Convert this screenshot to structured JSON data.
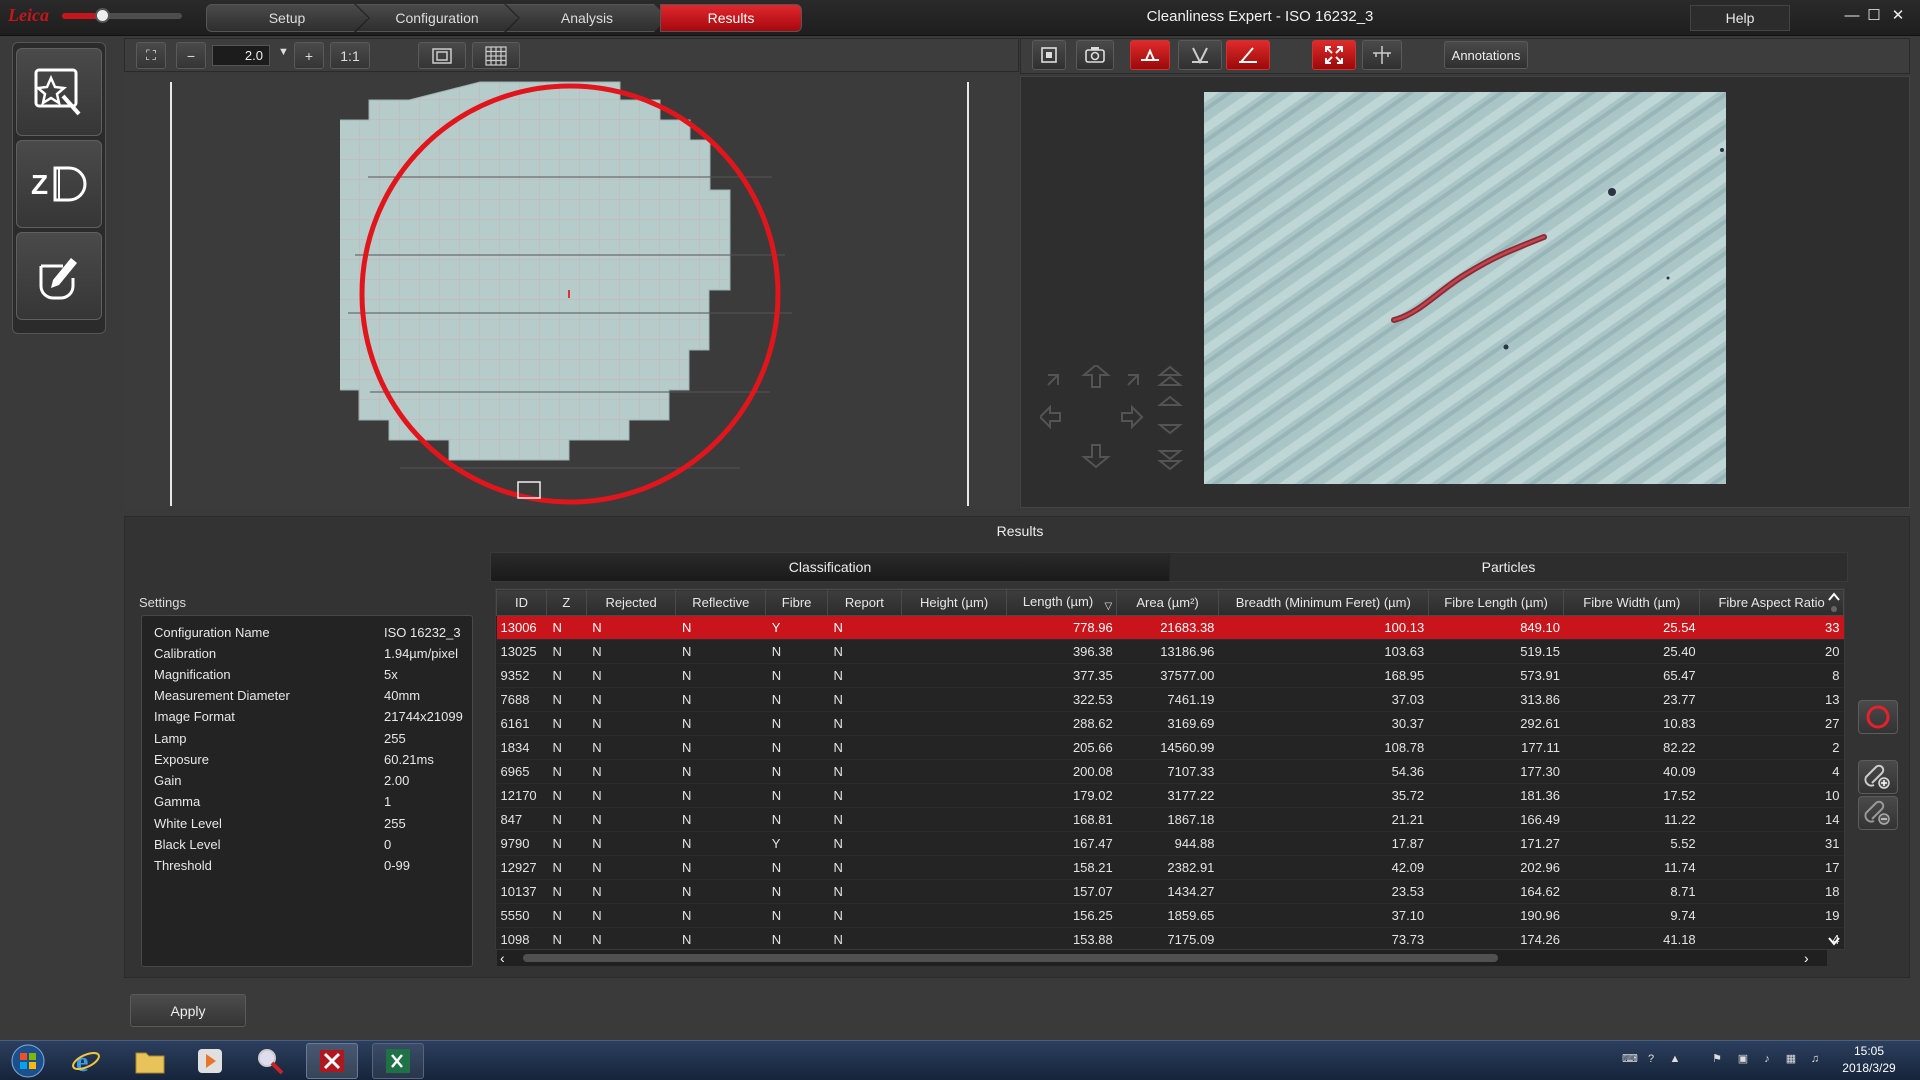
{
  "titlebar": {
    "logo_text": "Leica",
    "workflow_tabs": [
      {
        "label": "Setup"
      },
      {
        "label": "Configuration"
      },
      {
        "label": "Analysis"
      },
      {
        "label": "Results",
        "active": true
      }
    ],
    "app_title": "Cleanliness Expert - ISO 16232_3",
    "help_label": "Help",
    "accent_color": "#c4161c"
  },
  "left_toolbar": {
    "zoom_value": "2.0",
    "zoom_minus": "−",
    "zoom_plus": "+",
    "one_to_one": "1:1"
  },
  "right_toolbar": {
    "annotations_label": "Annotations"
  },
  "results": {
    "title": "Results",
    "tabs": [
      "Classification",
      "Particles"
    ],
    "active_tab": "Classification"
  },
  "settings": {
    "title": "Settings",
    "rows": [
      {
        "key": "Configuration Name",
        "value": "ISO 16232_3"
      },
      {
        "key": "Calibration",
        "value": "1.94µm/pixel"
      },
      {
        "key": "Magnification",
        "value": "5x"
      },
      {
        "key": "Measurement Diameter",
        "value": "40mm"
      },
      {
        "key": "Image Format",
        "value": "21744x21099"
      },
      {
        "key": "Lamp",
        "value": "255"
      },
      {
        "key": "Exposure",
        "value": "60.21ms"
      },
      {
        "key": "Gain",
        "value": "2.00"
      },
      {
        "key": "Gamma",
        "value": "1"
      },
      {
        "key": "White Level",
        "value": "255"
      },
      {
        "key": "Black Level",
        "value": "0"
      },
      {
        "key": "Threshold",
        "value": "0-99"
      }
    ]
  },
  "table": {
    "columns": [
      "ID",
      "Z",
      "Rejected",
      "Reflective",
      "Fibre",
      "Report",
      "Height (µm)",
      "Length (µm)",
      "Area (µm²)",
      "Breadth (Minimum Feret) (µm)",
      "Fibre Length (µm)",
      "Fibre Width (µm)",
      "Fibre Aspect Ratio"
    ],
    "sorted_column": "Length (µm)",
    "selected_row": 0,
    "rows": [
      [
        "13006",
        "N",
        "N",
        "N",
        "Y",
        "N",
        "",
        "778.96",
        "21683.38",
        "100.13",
        "849.10",
        "25.54",
        "33"
      ],
      [
        "13025",
        "N",
        "N",
        "N",
        "N",
        "N",
        "",
        "396.38",
        "13186.96",
        "103.63",
        "519.15",
        "25.40",
        "20"
      ],
      [
        "9352",
        "N",
        "N",
        "N",
        "N",
        "N",
        "",
        "377.35",
        "37577.00",
        "168.95",
        "573.91",
        "65.47",
        "8"
      ],
      [
        "7688",
        "N",
        "N",
        "N",
        "N",
        "N",
        "",
        "322.53",
        "7461.19",
        "37.03",
        "313.86",
        "23.77",
        "13"
      ],
      [
        "6161",
        "N",
        "N",
        "N",
        "N",
        "N",
        "",
        "288.62",
        "3169.69",
        "30.37",
        "292.61",
        "10.83",
        "27"
      ],
      [
        "1834",
        "N",
        "N",
        "N",
        "N",
        "N",
        "",
        "205.66",
        "14560.99",
        "108.78",
        "177.11",
        "82.22",
        "2"
      ],
      [
        "6965",
        "N",
        "N",
        "N",
        "N",
        "N",
        "",
        "200.08",
        "7107.33",
        "54.36",
        "177.30",
        "40.09",
        "4"
      ],
      [
        "12170",
        "N",
        "N",
        "N",
        "N",
        "N",
        "",
        "179.02",
        "3177.22",
        "35.72",
        "181.36",
        "17.52",
        "10"
      ],
      [
        "847",
        "N",
        "N",
        "N",
        "N",
        "N",
        "",
        "168.81",
        "1867.18",
        "21.21",
        "166.49",
        "11.22",
        "14"
      ],
      [
        "9790",
        "N",
        "N",
        "N",
        "Y",
        "N",
        "",
        "167.47",
        "944.88",
        "17.87",
        "171.27",
        "5.52",
        "31"
      ],
      [
        "12927",
        "N",
        "N",
        "N",
        "N",
        "N",
        "",
        "158.21",
        "2382.91",
        "42.09",
        "202.96",
        "11.74",
        "17"
      ],
      [
        "10137",
        "N",
        "N",
        "N",
        "N",
        "N",
        "",
        "157.07",
        "1434.27",
        "23.53",
        "164.62",
        "8.71",
        "18"
      ],
      [
        "5550",
        "N",
        "N",
        "N",
        "N",
        "N",
        "",
        "156.25",
        "1859.65",
        "37.10",
        "190.96",
        "9.74",
        "19"
      ],
      [
        "1098",
        "N",
        "N",
        "N",
        "N",
        "N",
        "",
        "153.88",
        "7175.09",
        "73.73",
        "174.26",
        "41.18",
        "4"
      ]
    ]
  },
  "apply_label": "Apply",
  "taskbar": {
    "time": "15:05",
    "date": "2018/3/29"
  }
}
